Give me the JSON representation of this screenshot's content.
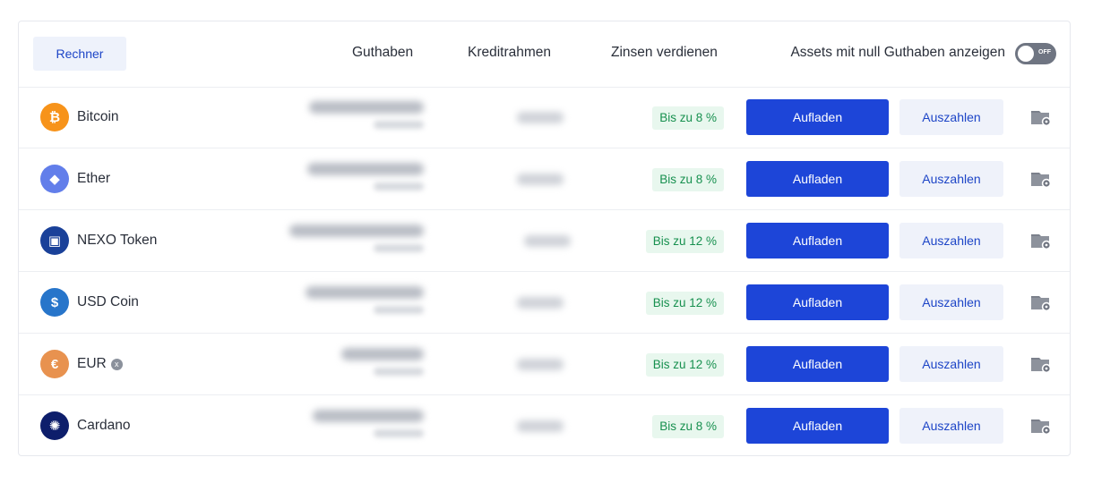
{
  "header": {
    "calculator_label": "Rechner",
    "col_balance": "Guthaben",
    "col_credit": "Kreditrahmen",
    "col_interest": "Zinsen verdienen",
    "zero_balance_label": "Assets mit null Guthaben anzeigen",
    "toggle_state": "OFF"
  },
  "actions": {
    "deposit": "Aufladen",
    "withdraw": "Auszahlen"
  },
  "assets": [
    {
      "name": "Bitcoin",
      "icon": "bitcoin-icon",
      "color": "#f7931a",
      "glyph": "₿",
      "rate": "Bis zu 8 %"
    },
    {
      "name": "Ether",
      "icon": "ethereum-icon",
      "color": "#627eea",
      "glyph": "◆",
      "rate": "Bis zu 8 %"
    },
    {
      "name": "NEXO Token",
      "icon": "nexo-icon",
      "color": "#1a4199",
      "glyph": "▣",
      "rate": "Bis zu 12 %"
    },
    {
      "name": "USD Coin",
      "icon": "usdc-icon",
      "color": "#2775ca",
      "glyph": "$",
      "rate": "Bis zu 12 %"
    },
    {
      "name": "EUR",
      "icon": "euro-icon",
      "color": "#e8924f",
      "glyph": "€",
      "rate": "Bis zu 12 %",
      "info": "x"
    },
    {
      "name": "Cardano",
      "icon": "cardano-icon",
      "color": "#0d1e6b",
      "glyph": "✺",
      "rate": "Bis zu 8 %"
    }
  ],
  "colors": {
    "primary": "#1d45d8",
    "rate_green": "#17904f",
    "rate_bg": "#e8f7ee",
    "secondary_bg": "#eff2fa"
  }
}
